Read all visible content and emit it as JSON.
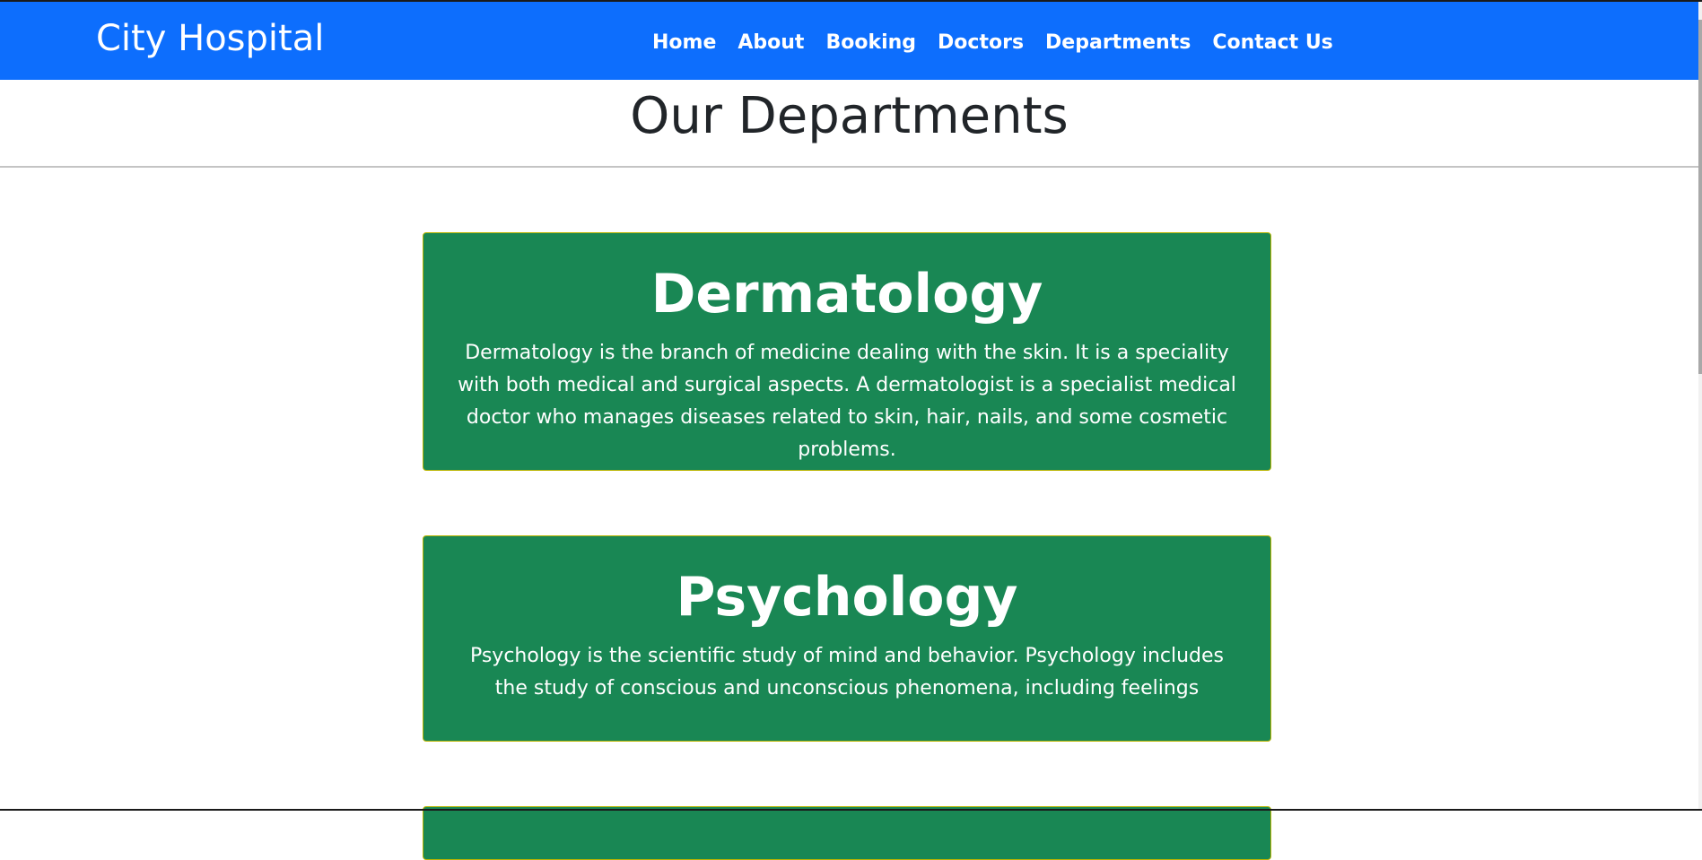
{
  "navbar": {
    "brand": "City Hospital",
    "links": [
      "Home",
      "About",
      "Booking",
      "Doctors",
      "Departments",
      "Contact Us"
    ],
    "color": "#0d6efd"
  },
  "page": {
    "title": "Our Departments"
  },
  "departments": [
    {
      "name": "Dermatology",
      "description": "Dermatology is the branch of medicine dealing with the skin. It is a speciality with both medical and surgical aspects. A dermatologist is a specialist medical doctor who manages diseases related to skin, hair, nails, and some cosmetic problems."
    },
    {
      "name": "Psychology",
      "description": "Psychology is the scientific study of mind and behavior. Psychology includes the study of conscious and unconscious phenomena, including feelings"
    }
  ],
  "card_color": "#198754"
}
